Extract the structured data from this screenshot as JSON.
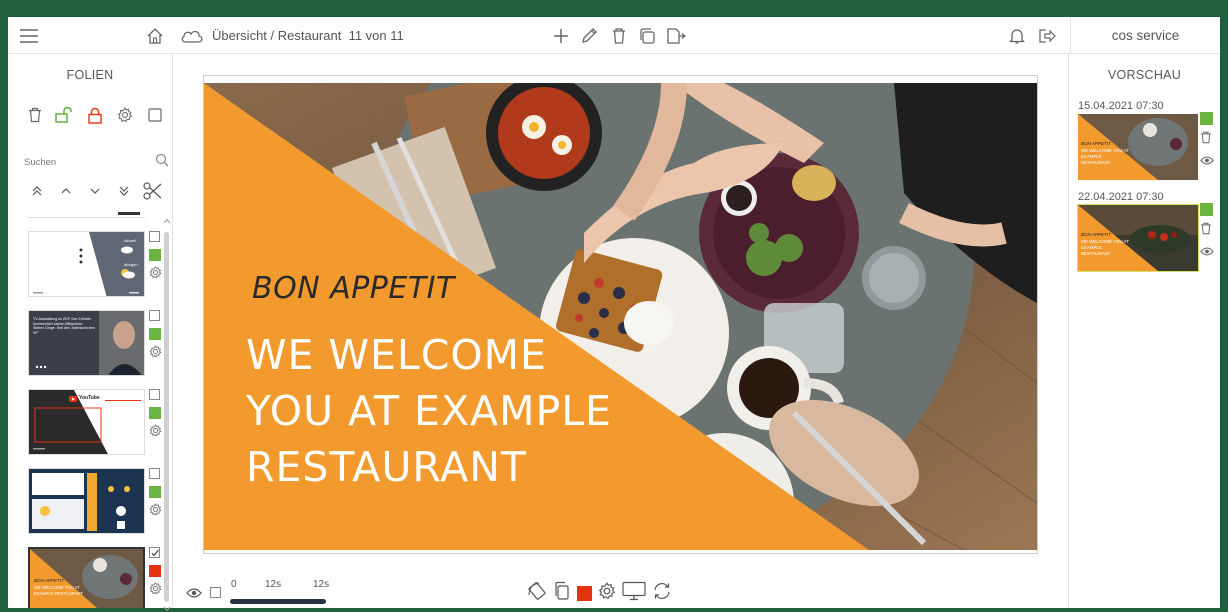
{
  "topbar": {
    "breadcrumb": "Übersicht / Restaurant",
    "counter": "11 von 11",
    "user": "cos service"
  },
  "left_panel": {
    "title": "FOLIEN",
    "search_placeholder": "Suchen",
    "slides": [
      {
        "selected": false,
        "status_color": "#6db33f",
        "thumb_kind": "weather"
      },
      {
        "selected": false,
        "status_color": "#6db33f",
        "thumb_kind": "person"
      },
      {
        "selected": false,
        "status_color": "#6db33f",
        "thumb_kind": "youtube"
      },
      {
        "selected": false,
        "status_color": "#6db33f",
        "thumb_kind": "dashboard"
      },
      {
        "selected": true,
        "status_color": "#e53310",
        "thumb_kind": "restaurant"
      }
    ],
    "thumb_texts": {
      "weather_a": "Aktuell",
      "weather_b": "Morgen",
      "person": "TV-Ausstellung im ZDF. Der Erfinder kommentiert seinen Bildschirm: Sieben Dinge: Seit den 'Ablenkzeichen XP'",
      "youtube": "YouTube",
      "restaurant_a": "BON APPETIT",
      "restaurant_b": "WE WELCOME YOU AT EXAMPLE RESTAURANT"
    }
  },
  "slide": {
    "bon_appetit": "BON APPETIT",
    "welcome_lines": [
      "WE WELCOME",
      "YOU AT EXAMPLE",
      "RESTAURANT"
    ]
  },
  "bottom": {
    "start": "0",
    "current": "12s",
    "total": "12s",
    "active_color": "#e53310"
  },
  "right_panel": {
    "title": "VORSCHAU",
    "previews": [
      {
        "date": "15.04.2021 07:30",
        "status_color": "#6db33f",
        "bon": "BON APPETIT",
        "lines": "WE WELCOME YOU AT EXAMPLE RESTAURANT"
      },
      {
        "date": "22.04.2021 07:30",
        "status_color": "#6db33f",
        "bon": "BON APPETIT",
        "lines": "WE WELCOME YOU AT EXAMPLE RESTAURANT"
      }
    ]
  },
  "colors": {
    "accent_orange": "#f39a2e",
    "frame_green": "#1f5f3b",
    "green": "#6db33f",
    "red": "#e53310"
  },
  "icons": [
    "menu-icon",
    "home-icon",
    "cloud-icon",
    "plus-icon",
    "pencil-icon",
    "trash-icon",
    "copy-icon",
    "export-icon",
    "bell-icon",
    "logout-icon",
    "lock-icon",
    "settings-icon",
    "search-icon",
    "scissors-icon",
    "eye-icon",
    "rotate-icon",
    "monitor-icon",
    "sync-icon"
  ]
}
